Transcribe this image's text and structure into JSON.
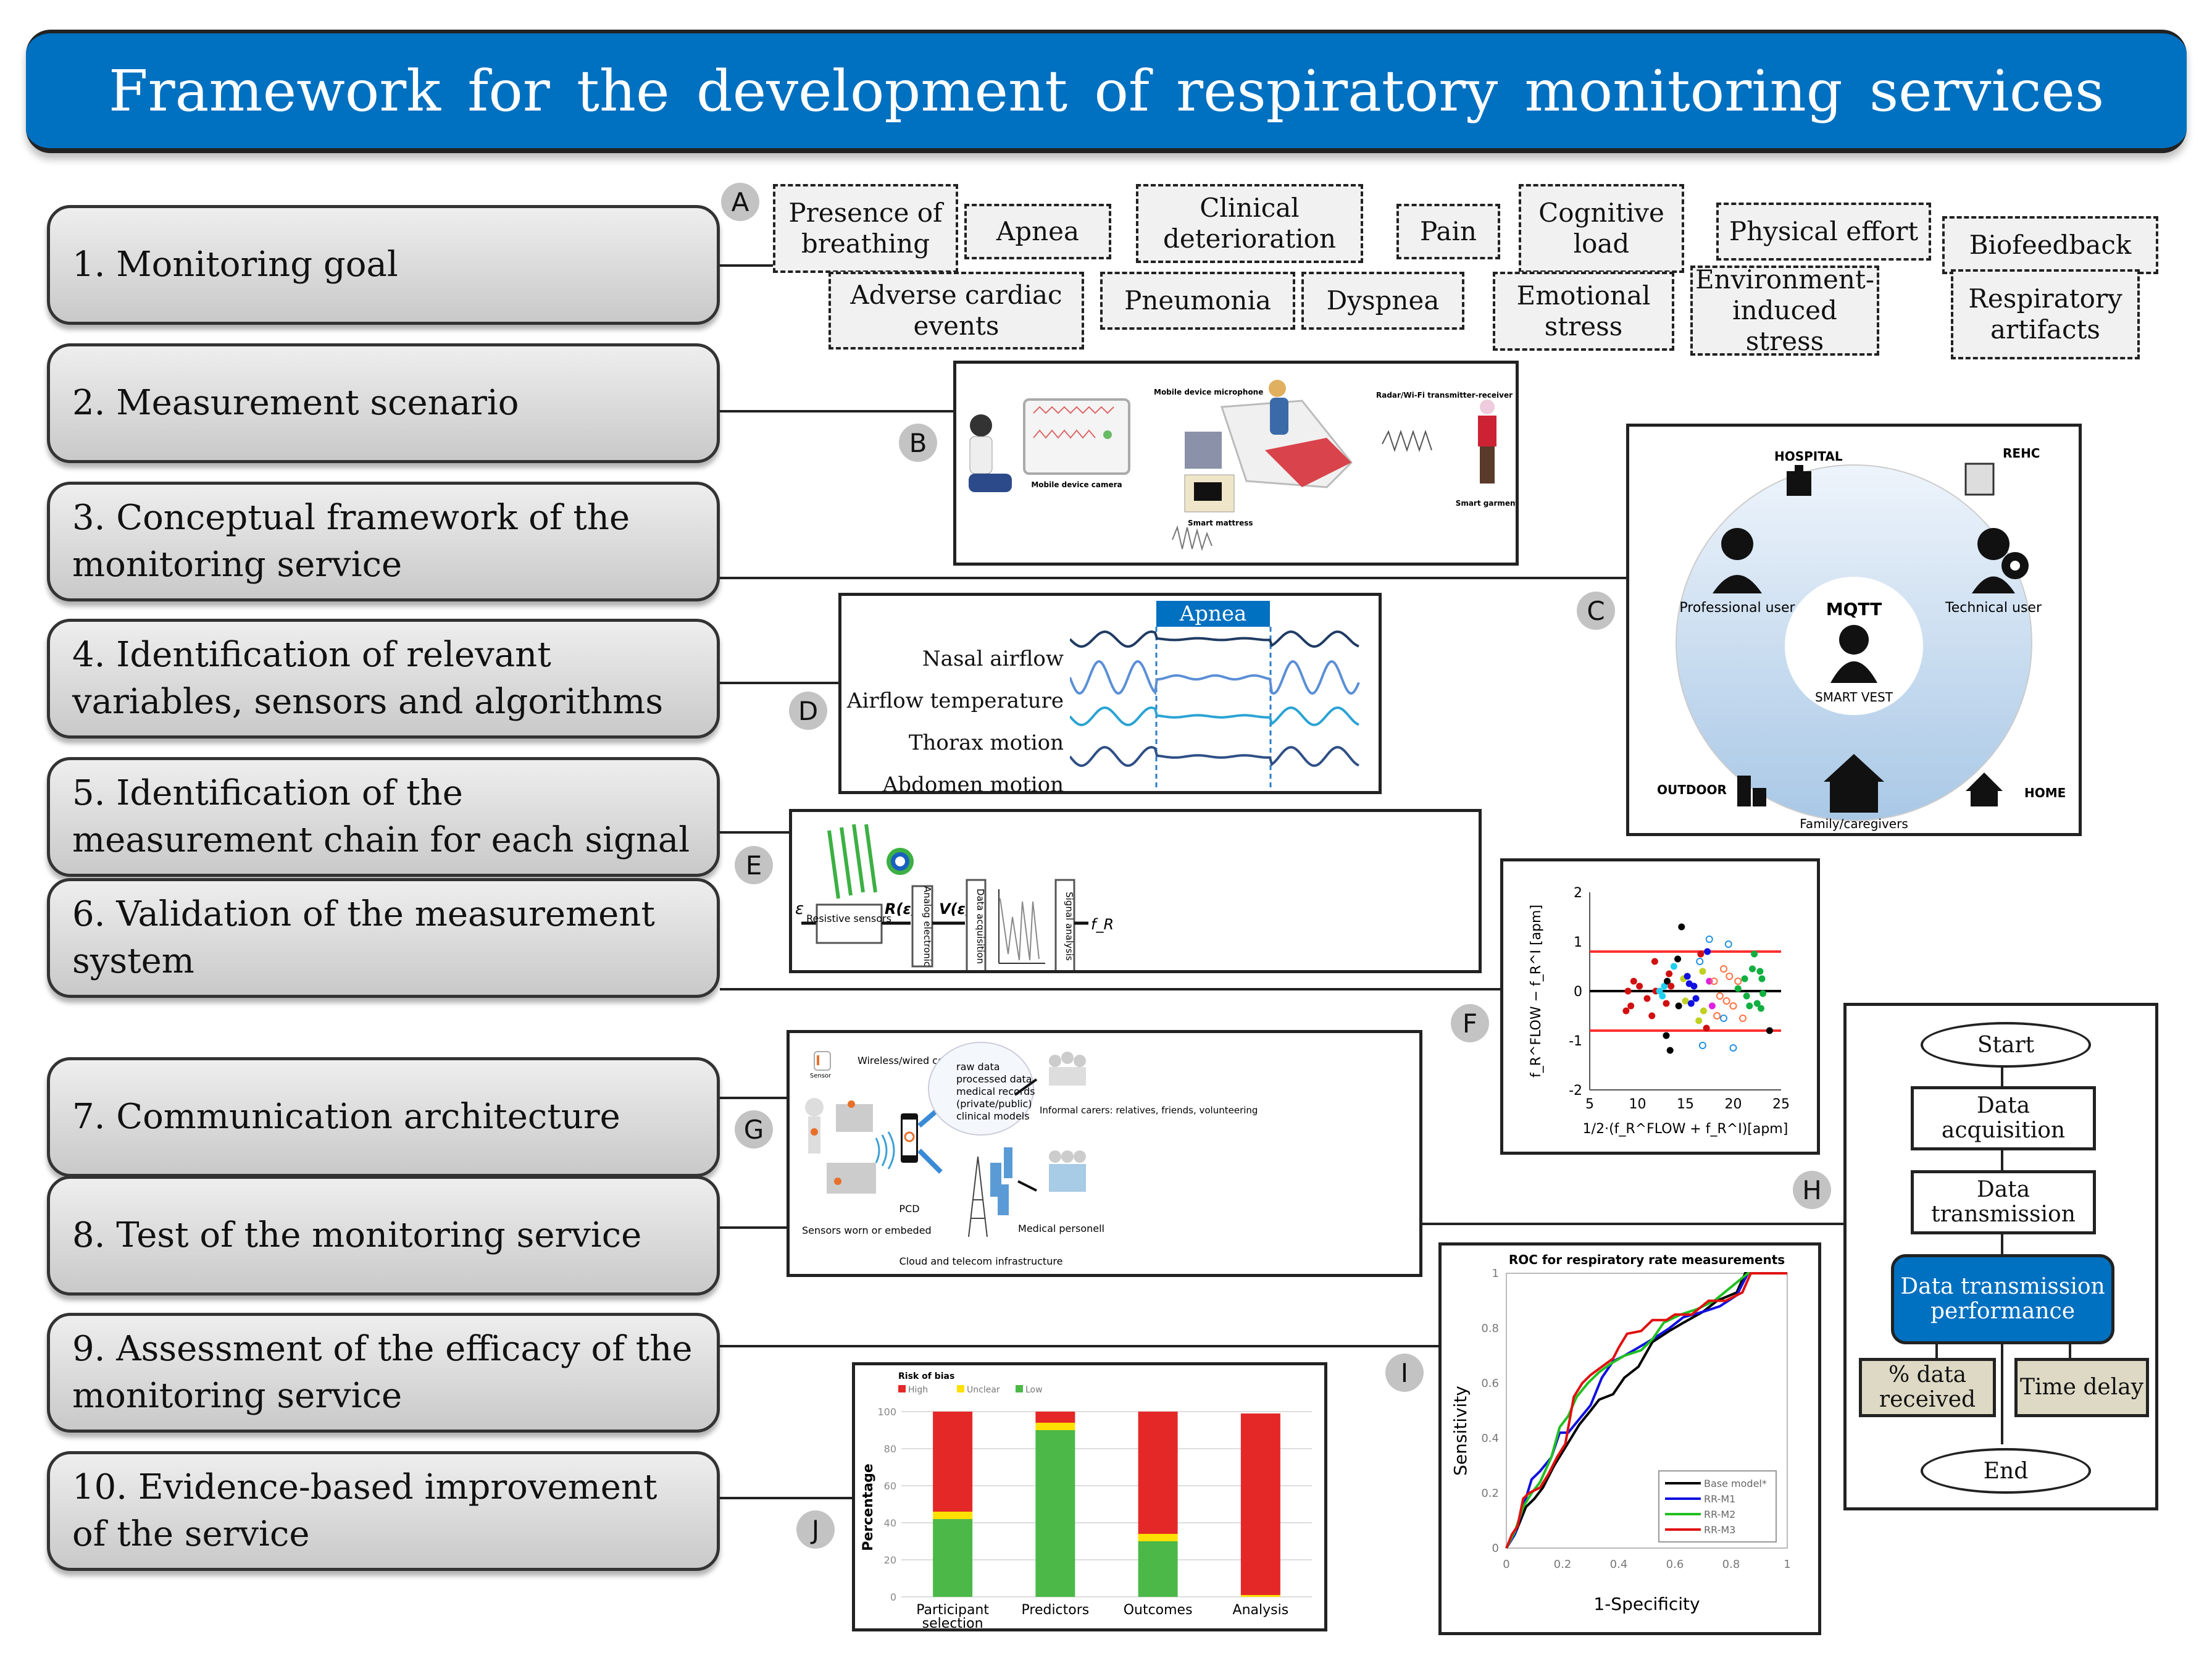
{
  "title": "Framework for the development of respiratory monitoring services",
  "steps": [
    {
      "label": "1. Monitoring  goal"
    },
    {
      "label": "2. Measurement  scenario"
    },
    {
      "label": "3. Conceptual  framework of the monitoring  service"
    },
    {
      "label": "4. Identification  of relevant variables, sensors  and algorithms"
    },
    {
      "label": "5. Identification  of the measurement  chain for each signal"
    },
    {
      "label": "6. Validation  of the measurement system"
    },
    {
      "label": "7. Communication  architecture"
    },
    {
      "label": "8. Test of the monitoring  service"
    },
    {
      "label": "9. Assessment  of the efficacy  of the monitoring  service"
    },
    {
      "label": "10. Evidence-based  improvement of the service"
    }
  ],
  "badges": [
    "A",
    "B",
    "C",
    "D",
    "E",
    "F",
    "G",
    "H",
    "I",
    "J"
  ],
  "panel_a": {
    "goals": [
      "Presence of breathing",
      "Apnea",
      "Clinical deterioration",
      "Pain",
      "Cognitive load",
      "Physical effort",
      "Biofeedback",
      "Adverse cardiac events",
      "Pneumonia",
      "Dyspnea",
      "Emotional stress",
      "Environment-induced stress",
      "Respiratory artifacts"
    ]
  },
  "panel_b": {
    "labels": [
      "Mobile device camera",
      "Mobile device microphone",
      "Radar/Wi-Fi transmitter-receiver",
      "Smart mattress",
      "Smart garment"
    ]
  },
  "panel_c": {
    "locations": [
      "HOSPITAL",
      "REHC",
      "OUTDOOR",
      "HOME"
    ],
    "users": [
      "Professional user",
      "Technical user",
      "Family/caregivers"
    ],
    "center_logo": "MQTT",
    "center_label": "SMART VEST"
  },
  "panel_d": {
    "event_label": "Apnea",
    "signals": [
      "Nasal airflow",
      "Airflow temperature",
      "Thorax motion",
      "Abdomen motion"
    ],
    "signal_colors": [
      "#1f3b63",
      "#5b8fd6",
      "#2aa3d3",
      "#2f4f85"
    ]
  },
  "panel_e": {
    "input": "ε",
    "blocks": [
      "Resistive sensors",
      "Analog electronic",
      "Data acquisition",
      "Signal analysis"
    ],
    "signals": [
      "R(ε)",
      "V(ε)"
    ],
    "output": "f_R"
  },
  "panel_g": {
    "labels": [
      "Wireless/wired communication",
      "Sensors worn or embeded",
      "PCD",
      "raw data",
      "processed data",
      "medical records",
      "(private/public)",
      "clinical models",
      "Cloud and telecom infrastructure",
      "Informal carers: relatives, friends, volunteering",
      "Medical personell",
      "Sensor"
    ]
  },
  "panel_h": {
    "start": "Start",
    "steps": [
      "Data acquisition",
      "Data transmission"
    ],
    "highlight": "Data transmission performance",
    "metrics": [
      "% data received",
      "Time delay"
    ],
    "end": "End",
    "highlight_color": "#0070c0",
    "metric_color": "#ddd9c4"
  },
  "chart_data": [
    {
      "id": "F",
      "type": "scatter",
      "title": "",
      "xlabel": "1/2·(f_R^FLOW + f_R^I)[apm]",
      "ylabel": "f_R^FLOW − f_R^I [apm]",
      "xlim": [
        5,
        25
      ],
      "ylim": [
        -2,
        2
      ],
      "xticks": [
        "5",
        "10",
        "15",
        "20",
        "25"
      ],
      "yticks": [
        "-2",
        "-1",
        "0",
        "1",
        "2"
      ],
      "reference_lines": [
        {
          "y": 0.8,
          "color": "#ff3030"
        },
        {
          "y": 0,
          "color": "#000000"
        },
        {
          "y": -0.8,
          "color": "#ff3030"
        }
      ],
      "points": [
        {
          "x": 8.8,
          "y": -0.4,
          "c": "#d01010"
        },
        {
          "x": 9.0,
          "y": 0.0,
          "c": "#d01010"
        },
        {
          "x": 9.3,
          "y": -0.3,
          "c": "#d01010"
        },
        {
          "x": 9.6,
          "y": 0.2,
          "c": "#d01010"
        },
        {
          "x": 10.2,
          "y": 0.1,
          "c": "#d01010"
        },
        {
          "x": 11.0,
          "y": -0.15,
          "c": "#d01010"
        },
        {
          "x": 11.5,
          "y": -0.5,
          "c": "#d01010"
        },
        {
          "x": 11.8,
          "y": 0.6,
          "c": "#d01010"
        },
        {
          "x": 11.9,
          "y": 0.0,
          "c": "#d01010"
        },
        {
          "x": 12.3,
          "y": 0.0,
          "c": "#20d0f0"
        },
        {
          "x": 12.6,
          "y": -0.1,
          "c": "#20d0f0"
        },
        {
          "x": 12.8,
          "y": 0.1,
          "c": "#20d0f0"
        },
        {
          "x": 13.0,
          "y": -0.25,
          "c": "#d01010"
        },
        {
          "x": 13.1,
          "y": 0.2,
          "c": "#000000"
        },
        {
          "x": 13.3,
          "y": 0.35,
          "c": "#d01010"
        },
        {
          "x": 13.5,
          "y": 0.1,
          "c": "#d01010"
        },
        {
          "x": 13.0,
          "y": -0.9,
          "c": "#000000"
        },
        {
          "x": 13.4,
          "y": -1.2,
          "c": "#000000"
        },
        {
          "x": 13.8,
          "y": 0.5,
          "c": "#20d0f0"
        },
        {
          "x": 14.2,
          "y": 0.65,
          "c": "#000000"
        },
        {
          "x": 14.3,
          "y": -0.3,
          "c": "#000000"
        },
        {
          "x": 14.6,
          "y": 1.3,
          "c": "#000000"
        },
        {
          "x": 14.8,
          "y": 0.25,
          "c": "#c0d020"
        },
        {
          "x": 15.0,
          "y": -0.2,
          "c": "#c0d020"
        },
        {
          "x": 15.2,
          "y": 0.3,
          "c": "#1010e0"
        },
        {
          "x": 15.4,
          "y": 0.15,
          "c": "#1010e0"
        },
        {
          "x": 15.6,
          "y": -0.25,
          "c": "#1010e0"
        },
        {
          "x": 15.9,
          "y": 0.1,
          "c": "#1010e0"
        },
        {
          "x": 16.1,
          "y": -0.15,
          "c": "#1010e0"
        },
        {
          "x": 16.4,
          "y": -0.6,
          "c": "#c0d020"
        },
        {
          "x": 16.6,
          "y": 0.75,
          "c": "#d01010"
        },
        {
          "x": 16.8,
          "y": 0.4,
          "c": "#c0d020"
        },
        {
          "x": 16.9,
          "y": -0.4,
          "c": "#c0d020"
        },
        {
          "x": 17.2,
          "y": -0.75,
          "c": "#d01010"
        },
        {
          "x": 17.3,
          "y": 0.8,
          "c": "#1010e0"
        },
        {
          "x": 17.5,
          "y": 0.2,
          "c": "#e020e0"
        },
        {
          "x": 17.8,
          "y": -0.3,
          "c": "#e020e0"
        },
        {
          "x": 18.0,
          "y": 0.2,
          "c": "#ff7040",
          "open": true
        },
        {
          "x": 18.3,
          "y": -0.5,
          "c": "#ff7040",
          "open": true
        },
        {
          "x": 18.6,
          "y": -0.1,
          "c": "#ff7040",
          "open": true
        },
        {
          "x": 19.0,
          "y": 0.45,
          "c": "#ff7040",
          "open": true
        },
        {
          "x": 19.3,
          "y": -0.2,
          "c": "#ff7040",
          "open": true
        },
        {
          "x": 19.6,
          "y": 0.3,
          "c": "#ff7040",
          "open": true
        },
        {
          "x": 20.0,
          "y": -0.3,
          "c": "#ff7040",
          "open": true
        },
        {
          "x": 20.5,
          "y": 0.2,
          "c": "#ff7040",
          "open": true
        },
        {
          "x": 21.0,
          "y": -0.55,
          "c": "#ff7040",
          "open": true
        },
        {
          "x": 17.5,
          "y": 1.05,
          "c": "#2090e0",
          "open": true
        },
        {
          "x": 19.5,
          "y": 0.95,
          "c": "#2090e0",
          "open": true
        },
        {
          "x": 16.8,
          "y": -1.1,
          "c": "#2090e0",
          "open": true
        },
        {
          "x": 20.0,
          "y": -1.15,
          "c": "#2090e0",
          "open": true
        },
        {
          "x": 16.5,
          "y": 0.6,
          "c": "#2090e0",
          "open": true
        },
        {
          "x": 19.0,
          "y": -0.55,
          "c": "#2090e0",
          "open": true
        },
        {
          "x": 20.5,
          "y": 0.05,
          "c": "#10b040"
        },
        {
          "x": 21.2,
          "y": 0.25,
          "c": "#10b040"
        },
        {
          "x": 21.4,
          "y": -0.1,
          "c": "#10b040"
        },
        {
          "x": 21.7,
          "y": -0.3,
          "c": "#10b040"
        },
        {
          "x": 22.0,
          "y": 0.45,
          "c": "#10b040"
        },
        {
          "x": 22.2,
          "y": 0.75,
          "c": "#10b040"
        },
        {
          "x": 22.5,
          "y": -0.25,
          "c": "#10b040"
        },
        {
          "x": 22.8,
          "y": 0.4,
          "c": "#10b040"
        },
        {
          "x": 22.9,
          "y": -0.35,
          "c": "#10b040"
        },
        {
          "x": 23.0,
          "y": 0.25,
          "c": "#10b040"
        },
        {
          "x": 23.1,
          "y": -0.05,
          "c": "#10b040"
        },
        {
          "x": 23.8,
          "y": -0.8,
          "c": "#000000"
        }
      ]
    },
    {
      "id": "I",
      "type": "line",
      "title": "ROC for respiratory rate measurements",
      "xlabel": "1-Specificity",
      "ylabel": "Sensitivity",
      "xlim": [
        0,
        1
      ],
      "ylim": [
        0,
        1
      ],
      "xticks": [
        "0",
        "0.2",
        "0.4",
        "0.6",
        "0.8",
        "1"
      ],
      "yticks": [
        "0",
        "0.2",
        "0.4",
        "0.6",
        "0.8",
        "1"
      ],
      "legend_position": "bottom-right",
      "series": [
        {
          "name": "Base model*",
          "color": "#000000",
          "x": [
            0,
            0.03,
            0.05,
            0.07,
            0.1,
            0.13,
            0.17,
            0.2,
            0.23,
            0.26,
            0.3,
            0.33,
            0.38,
            0.42,
            0.47,
            0.52,
            0.58,
            0.63,
            0.7,
            0.75,
            0.82,
            0.85,
            0.88,
            1
          ],
          "y": [
            0,
            0.05,
            0.1,
            0.15,
            0.18,
            0.22,
            0.3,
            0.35,
            0.4,
            0.45,
            0.5,
            0.54,
            0.56,
            0.62,
            0.66,
            0.75,
            0.79,
            0.82,
            0.86,
            0.9,
            0.93,
            1,
            1,
            1
          ]
        },
        {
          "name": "RR-M1",
          "color": "#1010e0",
          "x": [
            0,
            0.03,
            0.06,
            0.09,
            0.12,
            0.16,
            0.19,
            0.22,
            0.26,
            0.3,
            0.34,
            0.38,
            0.42,
            0.47,
            0.52,
            0.58,
            0.63,
            0.7,
            0.76,
            0.82,
            0.86,
            1
          ],
          "y": [
            0,
            0.05,
            0.15,
            0.25,
            0.28,
            0.33,
            0.42,
            0.42,
            0.47,
            0.52,
            0.62,
            0.68,
            0.7,
            0.73,
            0.76,
            0.8,
            0.84,
            0.86,
            0.88,
            0.92,
            1,
            1
          ]
        },
        {
          "name": "RR-M2",
          "color": "#20c020",
          "x": [
            0,
            0.03,
            0.06,
            0.09,
            0.12,
            0.16,
            0.19,
            0.22,
            0.25,
            0.29,
            0.33,
            0.37,
            0.42,
            0.48,
            0.52,
            0.56,
            0.62,
            0.68,
            0.74,
            0.8,
            0.86,
            1
          ],
          "y": [
            0,
            0.06,
            0.15,
            0.2,
            0.24,
            0.33,
            0.44,
            0.48,
            0.55,
            0.6,
            0.64,
            0.67,
            0.7,
            0.72,
            0.76,
            0.82,
            0.85,
            0.87,
            0.9,
            0.95,
            1,
            1
          ]
        },
        {
          "name": "RR-M3",
          "color": "#e01010",
          "x": [
            0,
            0.02,
            0.04,
            0.06,
            0.08,
            0.12,
            0.15,
            0.18,
            0.21,
            0.24,
            0.27,
            0.3,
            0.34,
            0.38,
            0.4,
            0.43,
            0.48,
            0.52,
            0.57,
            0.6,
            0.66,
            0.72,
            0.78,
            0.84,
            0.87,
            1
          ],
          "y": [
            0,
            0.05,
            0.08,
            0.18,
            0.2,
            0.22,
            0.27,
            0.33,
            0.38,
            0.55,
            0.6,
            0.63,
            0.66,
            0.69,
            0.73,
            0.78,
            0.79,
            0.83,
            0.83,
            0.85,
            0.85,
            0.9,
            0.9,
            0.93,
            1,
            1
          ]
        }
      ]
    },
    {
      "id": "J",
      "type": "bar",
      "stacked": true,
      "title": "",
      "legend_title": "Risk of bias",
      "legend_position": "top-left",
      "xlabel": "",
      "ylabel": "Percentage",
      "ylim": [
        0,
        100
      ],
      "yticks": [
        "0",
        "20",
        "40",
        "60",
        "80",
        "100"
      ],
      "categories": [
        "Participant selection",
        "Predictors",
        "Outcomes",
        "Analysis"
      ],
      "series": [
        {
          "name": "Low",
          "color": "#4cb848",
          "values": [
            42,
            90,
            30,
            0
          ]
        },
        {
          "name": "Unclear",
          "color": "#ffe000",
          "values": [
            4,
            4,
            4,
            1
          ]
        },
        {
          "name": "High",
          "color": "#e42828",
          "values": [
            54,
            6,
            66,
            98
          ]
        }
      ],
      "legend_order": [
        "High",
        "Unclear",
        "Low"
      ]
    }
  ]
}
